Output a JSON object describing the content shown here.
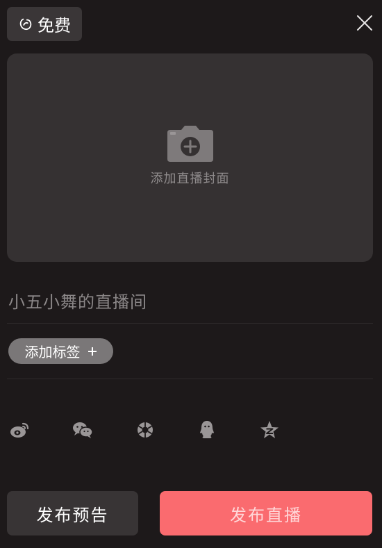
{
  "header": {
    "badge_icon": "tag-icon",
    "badge_label": "免费",
    "close_icon": "close-icon"
  },
  "cover": {
    "icon": "camera-add-icon",
    "label": "添加直播封面"
  },
  "room": {
    "title": "小五小舞的直播间"
  },
  "tags": {
    "add_label": "添加标签",
    "add_icon": "plus-icon"
  },
  "share": {
    "icons": [
      "weibo-icon",
      "wechat-icon",
      "moments-icon",
      "qq-icon",
      "qzone-icon"
    ]
  },
  "actions": {
    "preview_label": "发布预告",
    "live_label": "发布直播"
  },
  "colors": {
    "background": "#1d191a",
    "panel": "#353132",
    "accent": "#fa6b6f"
  }
}
